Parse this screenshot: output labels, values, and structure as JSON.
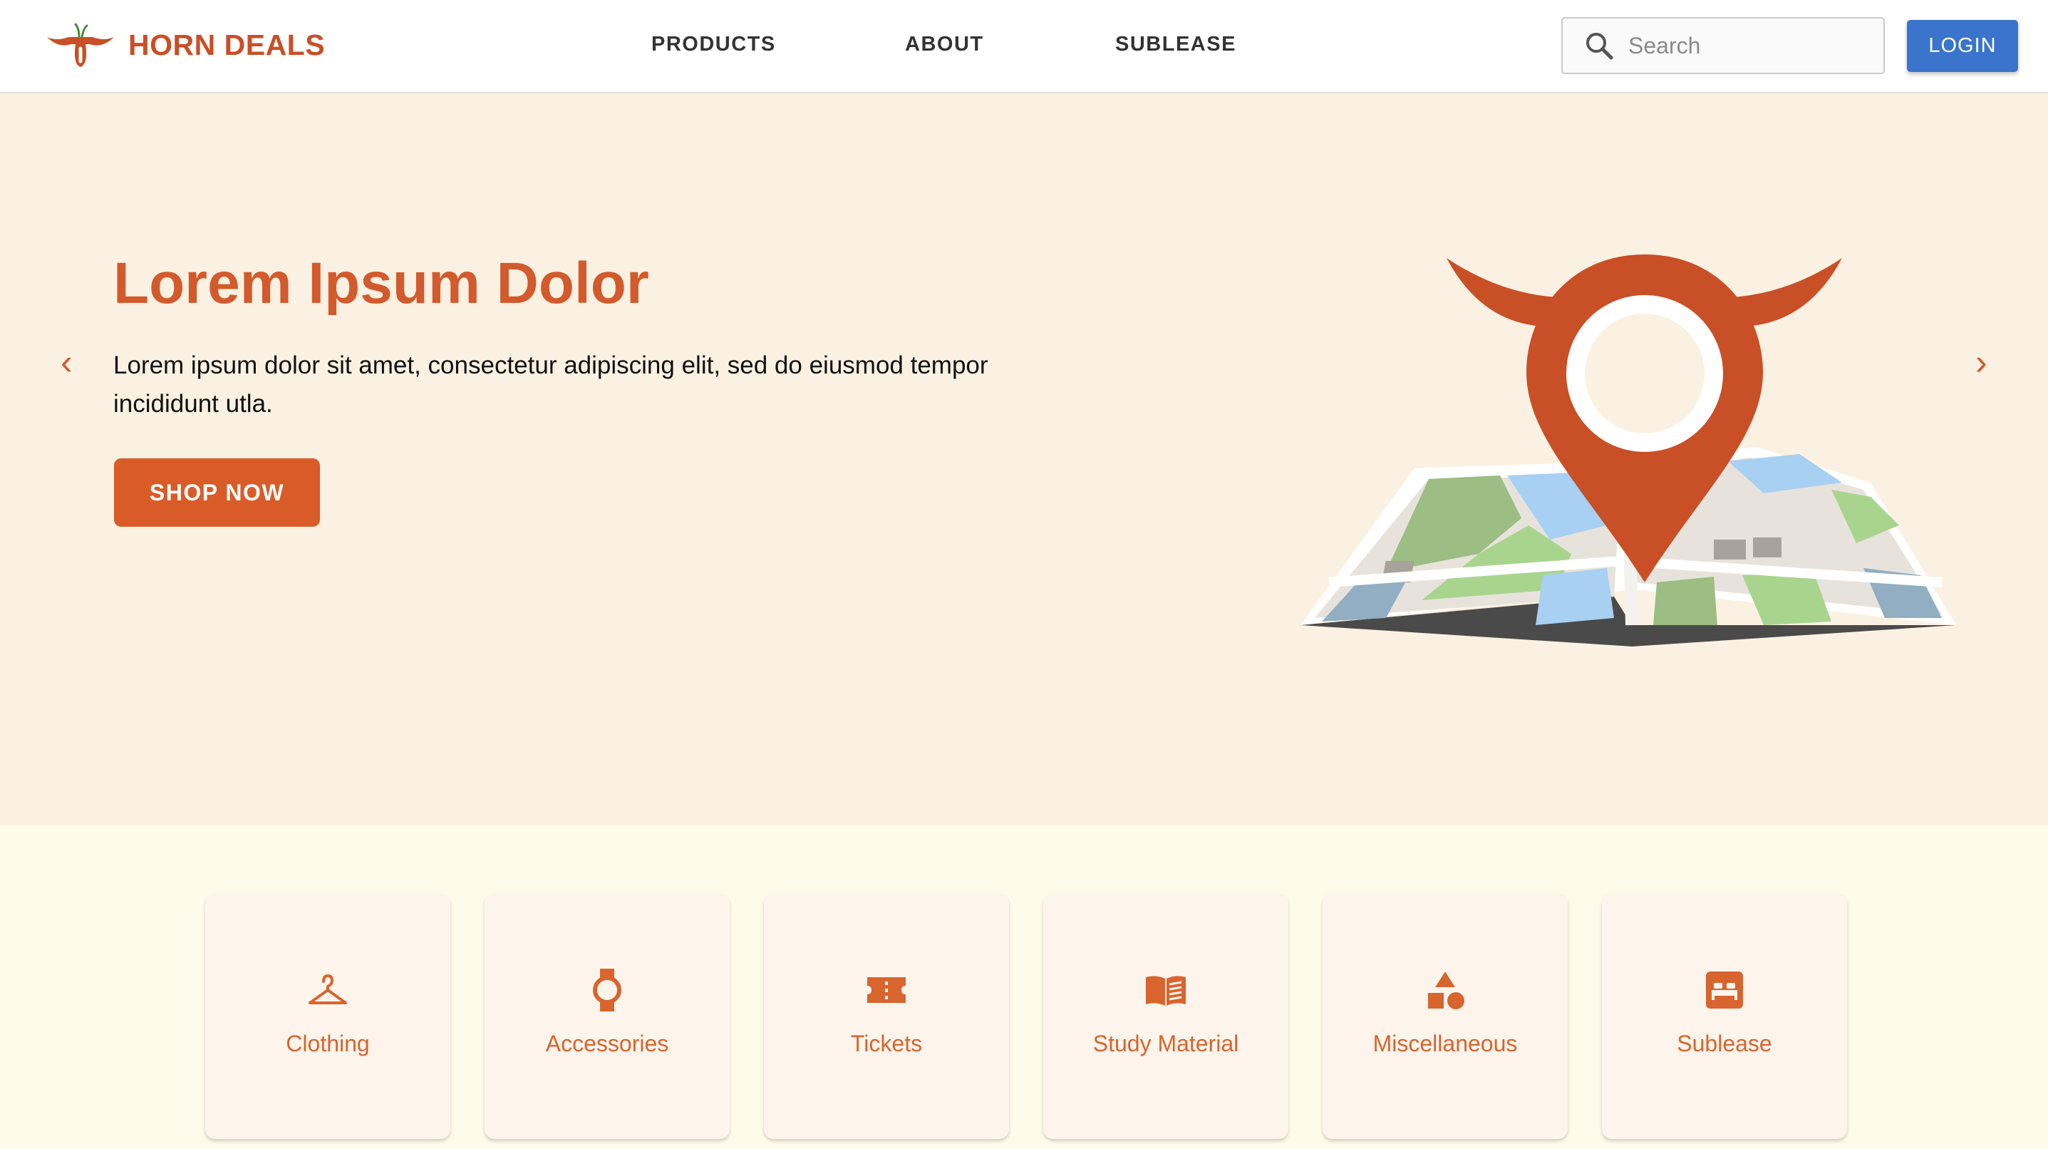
{
  "brand": {
    "name": "HORN DEALS"
  },
  "nav": {
    "products": "PRODUCTS",
    "about": "ABOUT",
    "sublease": "SUBLEASE"
  },
  "search": {
    "placeholder": "Search",
    "icon": "search-icon"
  },
  "login": {
    "label": "LOGIN"
  },
  "hero": {
    "title": "Lorem Ipsum Dolor",
    "body": "Lorem ipsum dolor sit amet, consectetur adipiscing elit, sed do eiusmod tempor incididunt utla.",
    "cta": "SHOP NOW",
    "prev": "‹",
    "next": "›"
  },
  "categories": [
    {
      "label": "Clothing",
      "icon": "hanger-icon"
    },
    {
      "label": "Accessories",
      "icon": "watch-icon"
    },
    {
      "label": "Tickets",
      "icon": "ticket-icon"
    },
    {
      "label": "Study Material",
      "icon": "book-icon"
    },
    {
      "label": "Miscellaneous",
      "icon": "shapes-icon"
    },
    {
      "label": "Sublease",
      "icon": "bed-icon"
    }
  ],
  "colors": {
    "brand": "#c94f26",
    "accent": "#d95c28",
    "login": "#3a74cc",
    "hero_bg": "#fbf1e2",
    "page_bg": "#fffbea"
  }
}
